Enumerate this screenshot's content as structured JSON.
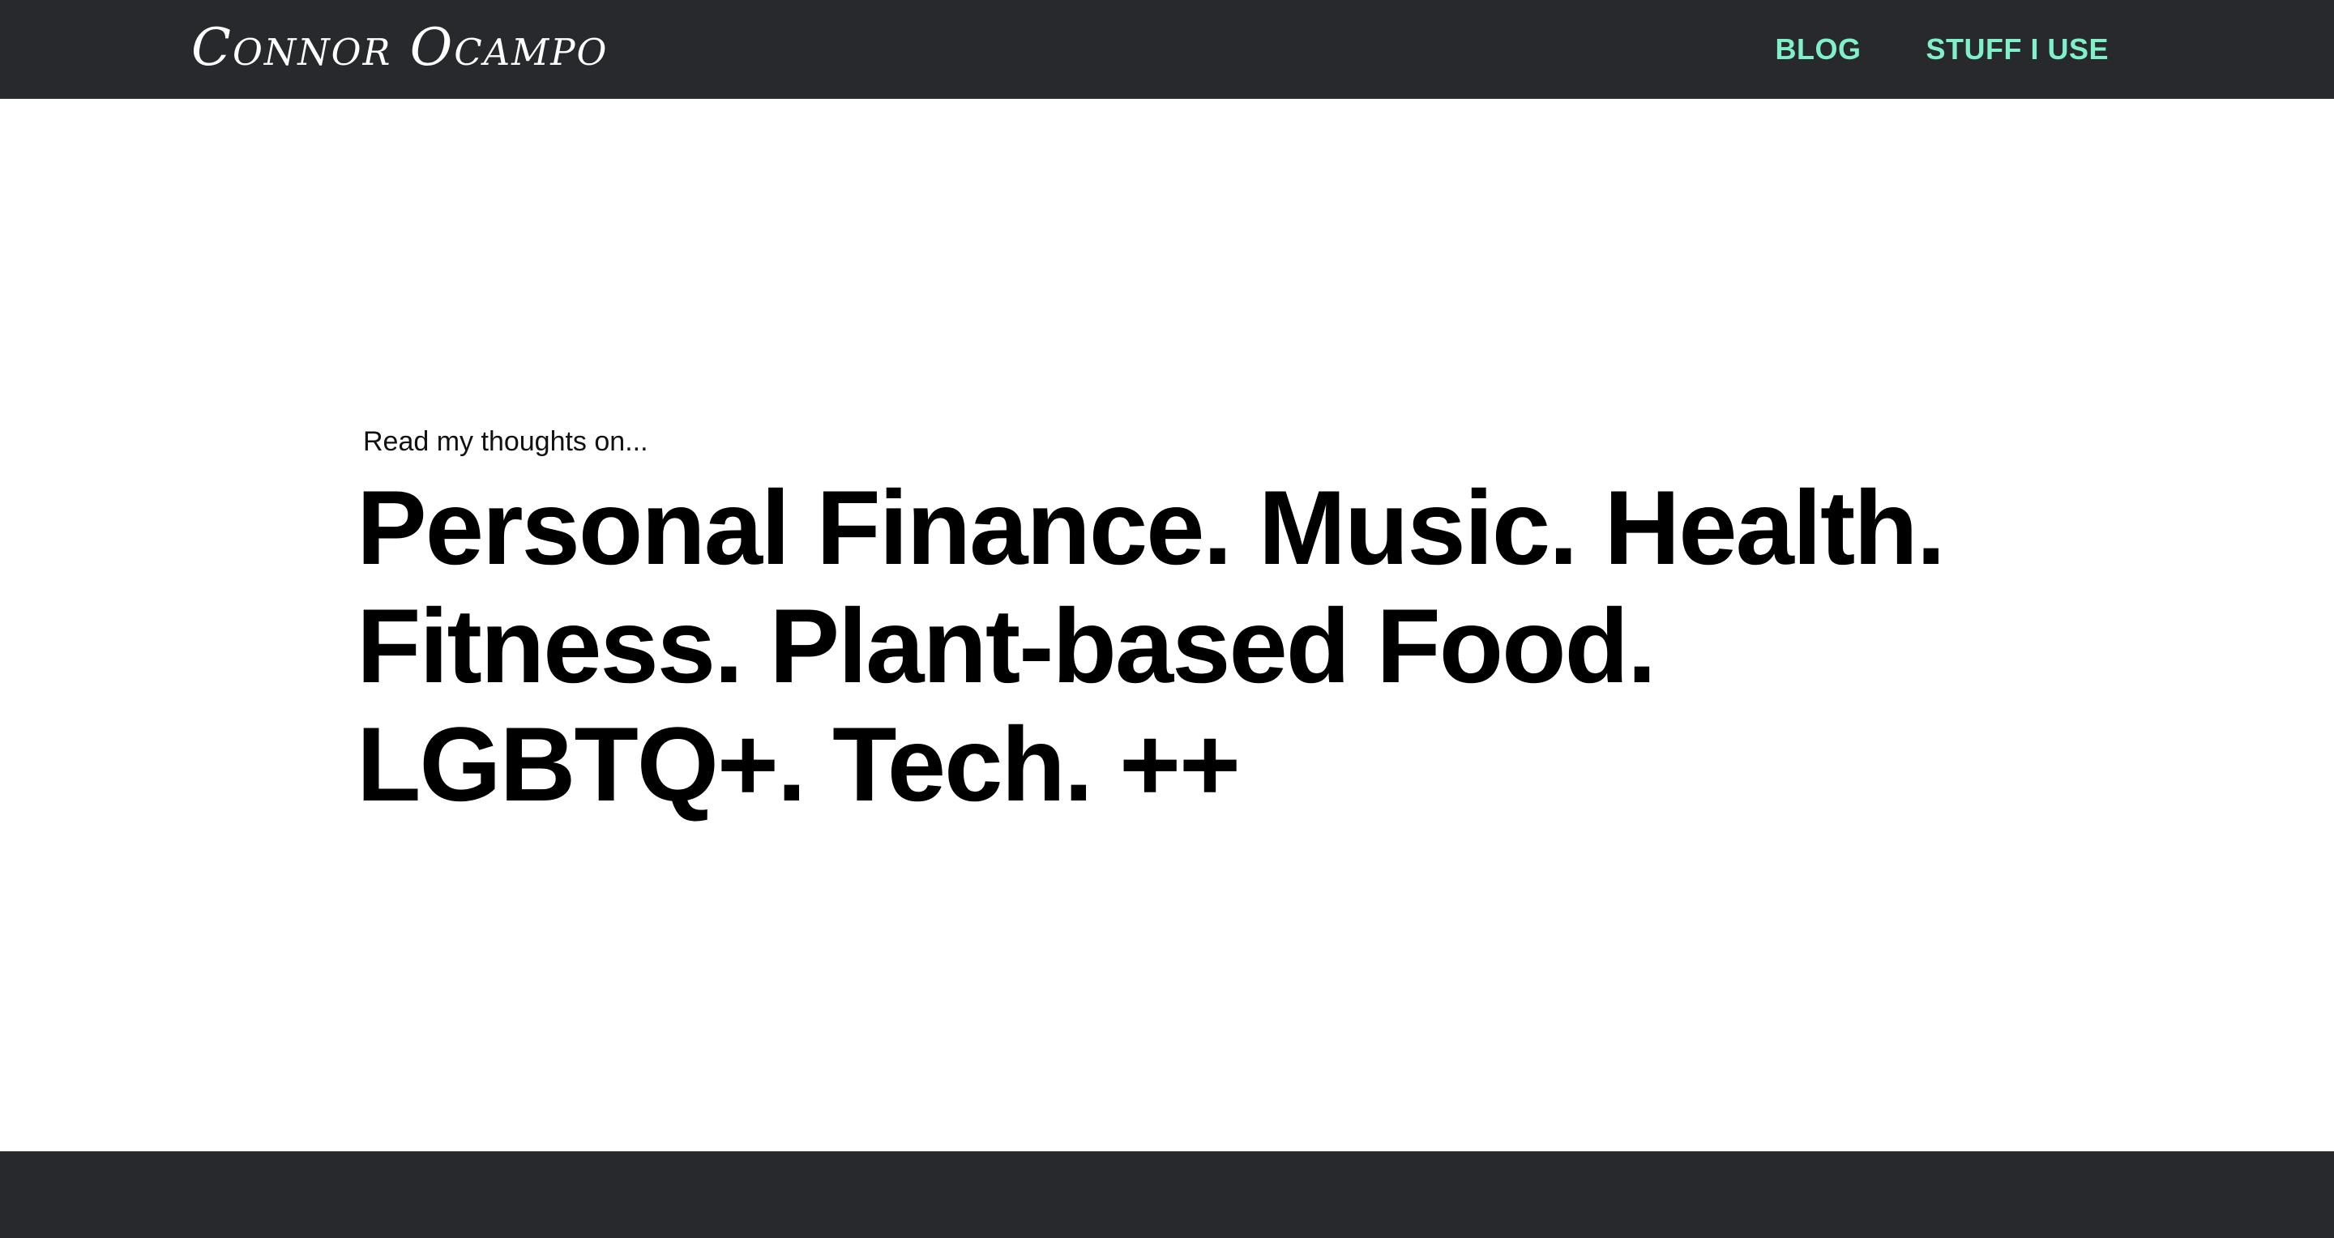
{
  "header": {
    "brand": {
      "first": "Connor",
      "last": "Ocampo"
    },
    "nav": [
      {
        "label": "BLOG"
      },
      {
        "label": "STUFF I USE"
      }
    ]
  },
  "hero": {
    "kicker": "Read my thoughts on...",
    "lines": [
      "Personal Finance. Music. Health.",
      "Fitness. Plant-based Food.",
      "LGBTQ+. Tech. ++"
    ]
  },
  "colors": {
    "bar_background": "#27292d",
    "nav_accent": "#7ff0c8",
    "page_background": "#ffffff",
    "headline_text": "#000000"
  }
}
